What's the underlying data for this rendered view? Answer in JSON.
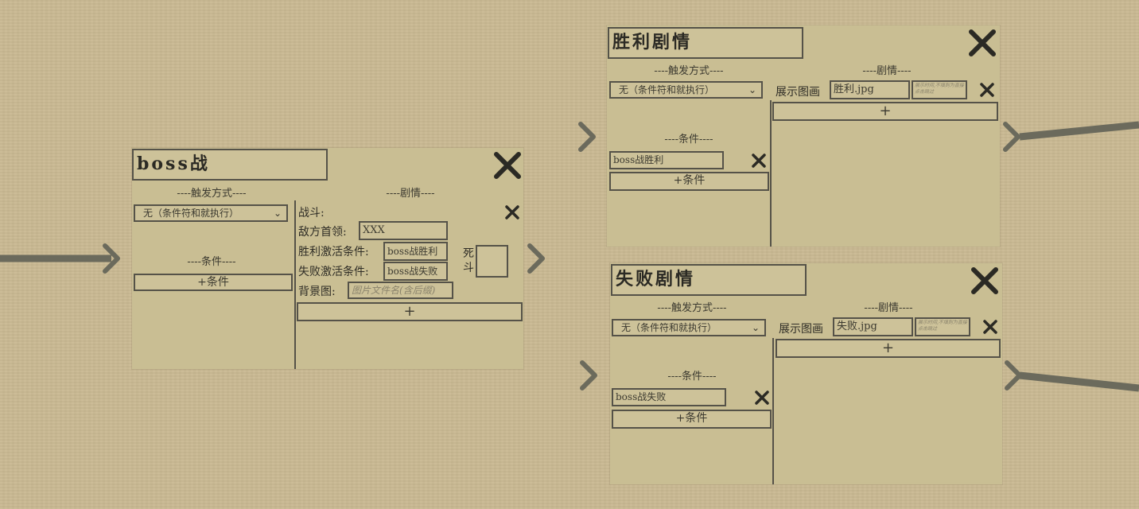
{
  "colors": {
    "background": "#c9b992",
    "panel": "#c9be93",
    "border": "#555248",
    "text": "#3c3a30",
    "wire": "#6b6a5c"
  },
  "nodes": {
    "boss": {
      "title": "boss战",
      "trigger_label": "----触发方式----",
      "trigger_value": "无（条件符和就执行）",
      "conditions_label": "----条件----",
      "add_condition": "+条件",
      "story_label": "----剧情----",
      "battle_label": "战斗:",
      "enemy_leader_label": "敌方首领:",
      "enemy_leader_value": "XXX",
      "win_condition_label": "胜利激活条件:",
      "win_condition_value": "boss战胜利",
      "lose_condition_label": "失败激活条件:",
      "lose_condition_value": "boss战失败",
      "death_fight_label": "死斗",
      "death_fight_checked": false,
      "background_label": "背景图:",
      "background_placeholder": "图片文件名(含后缀)",
      "add_story": "+"
    },
    "victory": {
      "title": "胜利剧情",
      "trigger_label": "----触发方式----",
      "trigger_value": "无（条件符和就执行）",
      "conditions_label": "----条件----",
      "condition_value": "boss战胜利",
      "add_condition": "+条件",
      "story_label": "----剧情----",
      "show_image_label": "展示图画",
      "image_value": "胜利.jpg",
      "time_hint": "展示时间,不填则为直接点击跳过",
      "add_story": "+"
    },
    "defeat": {
      "title": "失败剧情",
      "trigger_label": "----触发方式----",
      "trigger_value": "无（条件符和就执行）",
      "conditions_label": "----条件----",
      "condition_value": "boss战失败",
      "add_condition": "+条件",
      "story_label": "----剧情----",
      "show_image_label": "展示图画",
      "image_value": "失败.jpg",
      "time_hint": "展示时间,不填则为直接点击跳过",
      "add_story": "+"
    }
  }
}
